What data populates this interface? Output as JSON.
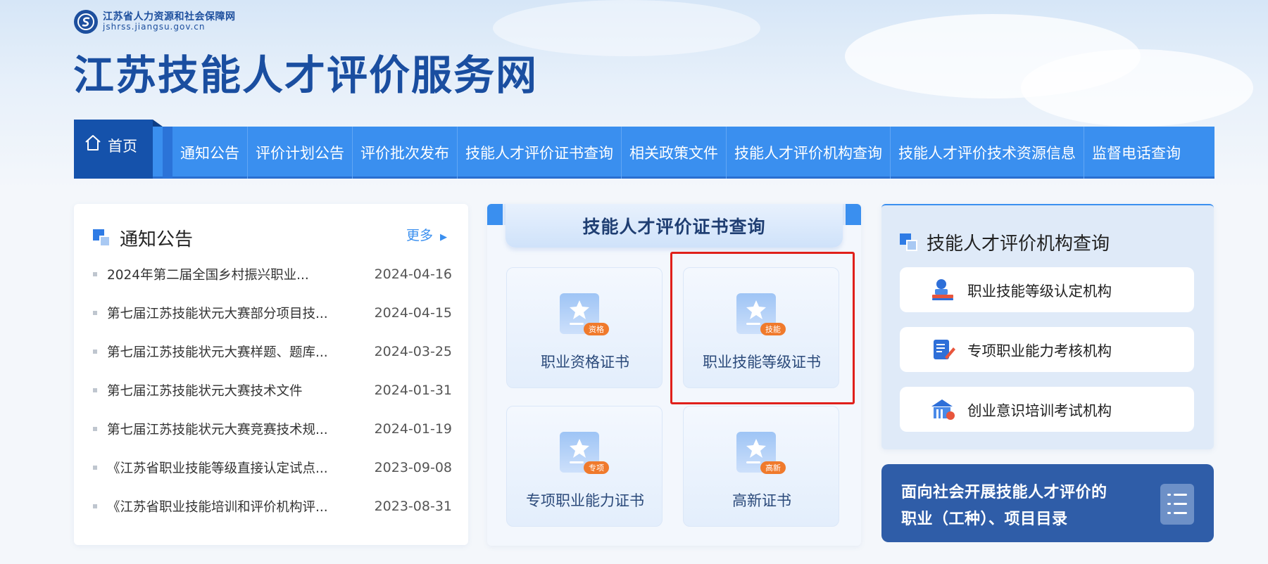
{
  "header": {
    "logo_cn": "江苏省人力资源和社会保障网",
    "logo_en": "jshrss.jiangsu.gov.cn",
    "site_title": "江苏技能人才评价服务网"
  },
  "nav": {
    "home_label": "首页",
    "items": [
      "通知公告",
      "评价计划公告",
      "评价批次发布",
      "技能人才评价证书查询",
      "相关政策文件",
      "技能人才评价机构查询",
      "技能人才评价技术资源信息",
      "监督电话查询"
    ]
  },
  "notice": {
    "title": "通知公告",
    "more_label": "更多",
    "items": [
      {
        "title": "2024年第二届全国乡村振兴职业...",
        "date": "2024-04-16"
      },
      {
        "title": "第七届江苏技能状元大赛部分项目技...",
        "date": "2024-04-15"
      },
      {
        "title": "第七届江苏技能状元大赛样题、题库...",
        "date": "2024-03-25"
      },
      {
        "title": "第七届江苏技能状元大赛技术文件",
        "date": "2024-01-31"
      },
      {
        "title": "第七届江苏技能状元大赛竞赛技术规...",
        "date": "2024-01-19"
      },
      {
        "title": "《江苏省职业技能等级直接认定试点...",
        "date": "2023-09-08"
      },
      {
        "title": "《江苏省职业技能培训和评价机构评...",
        "date": "2023-08-31"
      }
    ]
  },
  "cert_query": {
    "title": "技能人才评价证书查询",
    "tiles": [
      {
        "label": "职业资格证书",
        "badge": "资格"
      },
      {
        "label": "职业技能等级证书",
        "badge": "技能"
      },
      {
        "label": "专项职业能力证书",
        "badge": "专项"
      },
      {
        "label": "高新证书",
        "badge": "高新"
      }
    ]
  },
  "agency_query": {
    "title": "技能人才评价机构查询",
    "items": [
      {
        "label": "职业技能等级认定机构",
        "icon": "certification-agency-icon"
      },
      {
        "label": "专项职业能力考核机构",
        "icon": "assessment-document-icon"
      },
      {
        "label": "创业意识培训考试机构",
        "icon": "training-institution-icon"
      }
    ]
  },
  "banner": {
    "line1": "面向社会开展技能人才评价的",
    "line2": "职业（工种）、项目目录"
  },
  "colors": {
    "nav_blue": "#3a8fef",
    "home_blue": "#1552ab",
    "badge_orange": "#f07a2c",
    "banner_blue": "#2f5da8",
    "highlight_red": "#e0201b"
  }
}
